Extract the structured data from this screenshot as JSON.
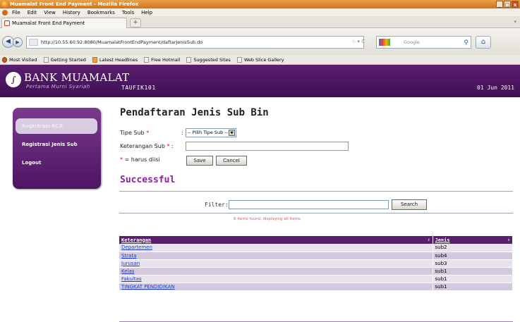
{
  "browser": {
    "window_title": "Muamalat Front End Payment - Mozilla Firefox",
    "window_buttons": [
      "_",
      "□",
      "x"
    ],
    "menu": [
      "File",
      "Edit",
      "View",
      "History",
      "Bookmarks",
      "Tools",
      "Help"
    ],
    "tab_title": "Muamalat Front End Payment",
    "new_tab": "+",
    "url": "http://10.55.60.92:8080/MuamalatFrontEndPayment/daftarJenisSub.do",
    "search_placeholder": "Google",
    "bookmarks": [
      "Most Visited",
      "Getting Started",
      "Latest Headlines",
      "Free Hotmail",
      "Suggested Sites",
      "Web Slice Gallery"
    ]
  },
  "header": {
    "logo_mark": "∫",
    "logo_text": "BANK MUAMALAT",
    "tagline": "Pertama Murni Syariah",
    "user": "TAUFIK101",
    "date": "01 Jun 2011"
  },
  "sidebar": {
    "items": [
      {
        "label": "Registrasi BCB"
      },
      {
        "label": "Registrasi Jenis Sub"
      },
      {
        "label": "Logout"
      }
    ]
  },
  "form": {
    "title": "Pendaftaran Jenis Sub Bin",
    "tipe_label": "Tipe Sub",
    "tipe_colon": ":",
    "tipe_value": "-- Pilih Tipe Sub --",
    "ket_label": "Keterangan Sub",
    "ket_colon": ":",
    "ket_value": "",
    "required_note": "= harus diisi",
    "asterisk": "*",
    "save": "Save",
    "cancel": "Cancel"
  },
  "result": {
    "status": "Successful",
    "filter_label": "Filter:",
    "filter_value": "",
    "search_button": "Search",
    "found_text": "6 items found, displaying all items.",
    "columns": [
      "Keterangan",
      "Jenis"
    ],
    "rows": [
      {
        "keterangan": "Departemen",
        "jenis": "sub2"
      },
      {
        "keterangan": "Strata",
        "jenis": "sub4"
      },
      {
        "keterangan": "Jurusan",
        "jenis": "sub3"
      },
      {
        "keterangan": "Kelas",
        "jenis": "sub1"
      },
      {
        "keterangan": "Fakultas",
        "jenis": "sub1"
      },
      {
        "keterangan": "TINGKAT PENDIDIKAN",
        "jenis": "sub1"
      }
    ]
  },
  "colors": {
    "brand_purple": "#5a1e6e",
    "success_text": "#8a1fa4",
    "link": "#1b3fc8",
    "required": "#d0122a"
  }
}
